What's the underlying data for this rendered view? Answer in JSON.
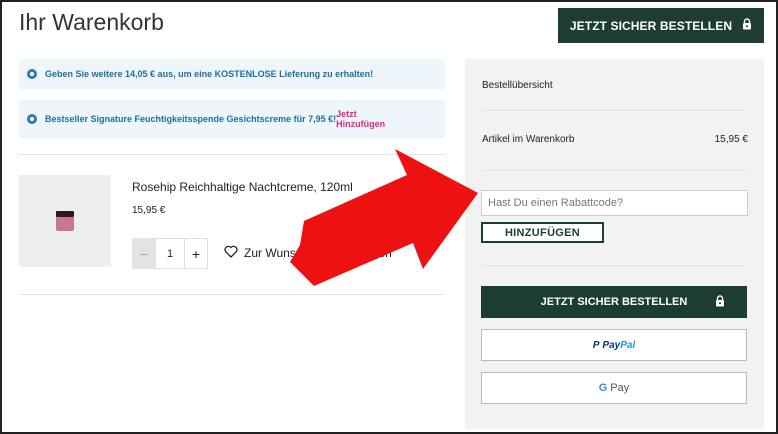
{
  "header": {
    "title": "Ihr Warenkorb",
    "checkout_label": "JETZT SICHER BESTELLEN"
  },
  "banners": [
    {
      "text": "Geben Sie weitere 14,05 € aus, um eine KOSTENLOSE Lieferung zu erhalten!"
    },
    {
      "text": "Bestseller Signature Feuchtigkeitsspende Gesichtscreme für 7,95 €!",
      "link": "Jetzt Hinzufügen"
    }
  ],
  "cart_item": {
    "name": "Rosehip Reichhaltige Nachtcreme, 120ml",
    "price": "15,95 €",
    "quantity": "1",
    "minus": "−",
    "plus": "+",
    "wishlist_label": "Zur Wunschliste hinzufügen"
  },
  "summary": {
    "title": "Bestellübersicht",
    "items_label": "Artikel im Warenkorb",
    "items_value": "15,95 €",
    "coupon_placeholder": "Hast Du einen Rabattcode?",
    "apply_label": "HINZUFÜGEN",
    "checkout_label": "JETZT SICHER BESTELLEN",
    "paypal_pay": "Pay",
    "paypal_pal": "Pal",
    "gpay_g": "G",
    "gpay_label": "Pay"
  },
  "colors": {
    "brand_green": "#1d3c34",
    "banner_bg": "#eef6fb",
    "banner_text": "#1f6e9e",
    "link_pink": "#e0297a",
    "arrow_red": "#ee1111"
  }
}
